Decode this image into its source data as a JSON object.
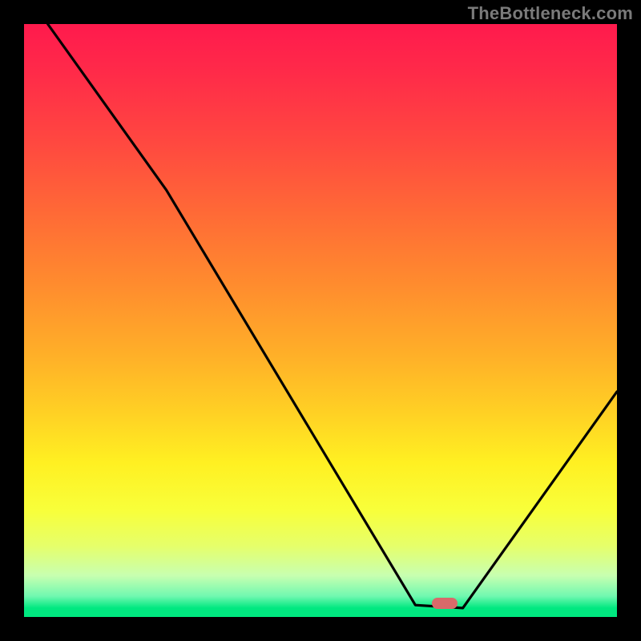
{
  "watermark": "TheBottleneck.com",
  "chart_data": {
    "type": "line",
    "title": "",
    "xlabel": "",
    "ylabel": "",
    "xlim": [
      0,
      100
    ],
    "ylim": [
      0,
      100
    ],
    "grid": false,
    "curve": [
      {
        "x": 4,
        "y": 100
      },
      {
        "x": 24,
        "y": 72
      },
      {
        "x": 66,
        "y": 2
      },
      {
        "x": 74,
        "y": 1.5
      },
      {
        "x": 100,
        "y": 38
      }
    ],
    "marker": {
      "x": 71,
      "y": 2.3,
      "color": "#d86a6a"
    },
    "background_gradient": {
      "top": "#ff1a4d",
      "mid": "#ffd224",
      "bottom": "#00e880"
    }
  }
}
